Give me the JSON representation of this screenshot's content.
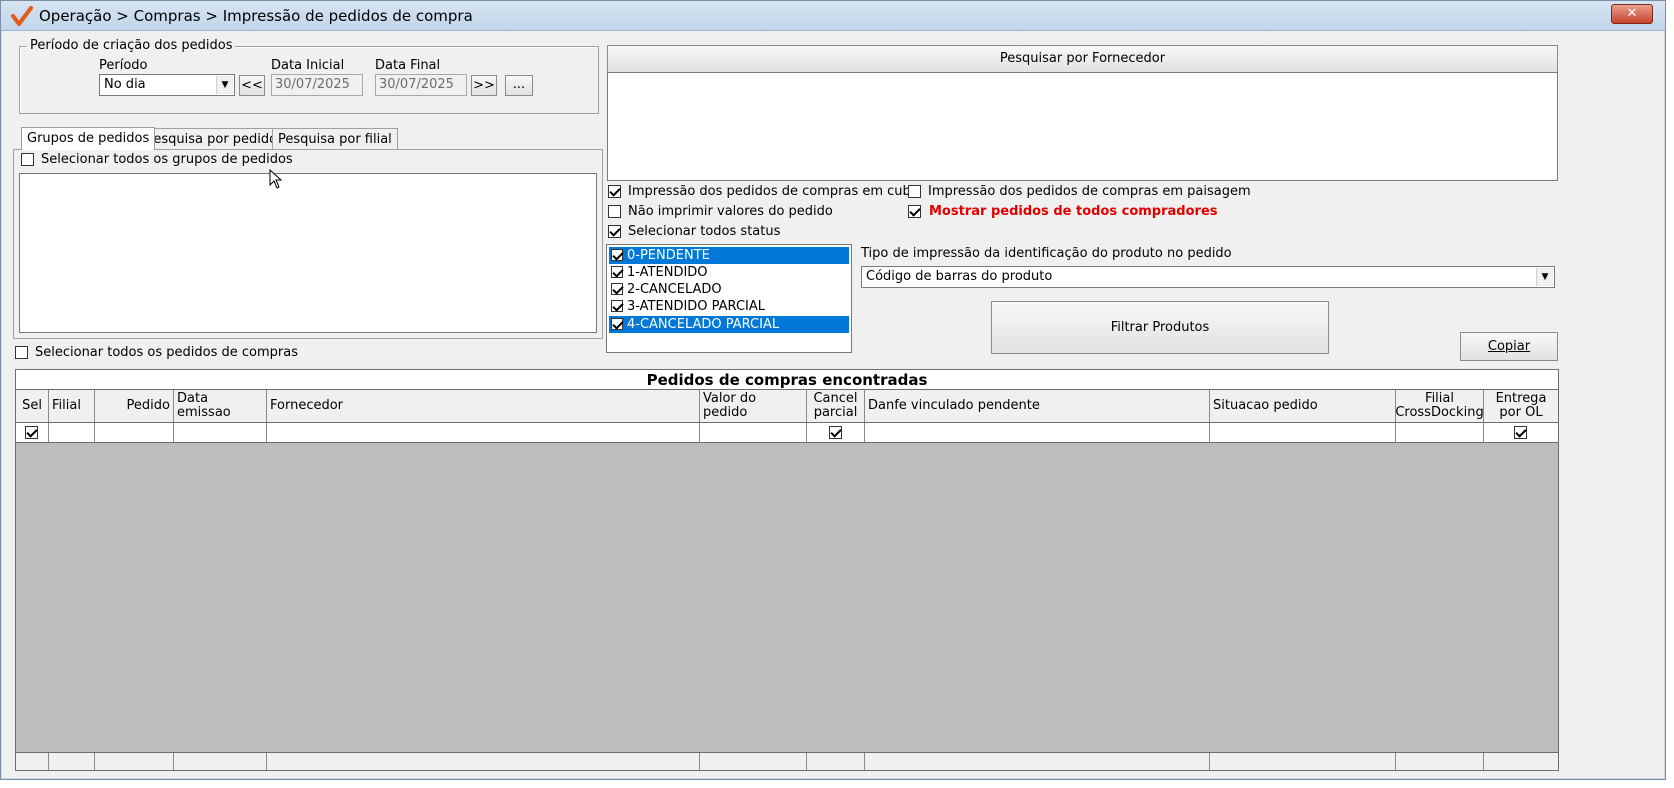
{
  "window": {
    "title": "Operação > Compras > Impressão de pedidos de compra",
    "close_label": "✕"
  },
  "periodo_group": {
    "legend": "Período de criação dos pedidos",
    "periodo_label": "Período",
    "periodo_value": "No dia",
    "prev_label": "<<",
    "data_inicial_label": "Data Inicial",
    "data_inicial_value": "30/07/2025",
    "data_final_label": "Data Final",
    "data_final_value": "30/07/2025",
    "next_label": ">>",
    "more_label": "..."
  },
  "tabs": [
    {
      "label": "Grupos de pedidos",
      "active": true
    },
    {
      "label": "Pesquisa por pedido",
      "active": false
    },
    {
      "label": "Pesquisa por filial",
      "active": false
    }
  ],
  "grupos": {
    "select_all_label": "Selecionar todos os grupos de pedidos",
    "select_all_checked": false
  },
  "select_all_pedidos_label": "Selecionar todos os pedidos de compras",
  "fornecedor": {
    "header_label": "Pesquisar por Fornecedor"
  },
  "options": {
    "cubo_label": "Impressão dos pedidos de compras em cubo",
    "cubo_checked": true,
    "paisagem_label": "Impressão dos pedidos de compras em paisagem",
    "paisagem_checked": false,
    "nao_imprimir_label": "Não imprimir valores do pedido",
    "nao_imprimir_checked": false,
    "mostrar_todos_label": "Mostrar pedidos de todos compradores",
    "mostrar_todos_checked": true,
    "mostrar_todos_color": "#e00000",
    "selecionar_status_label": "Selecionar todos status",
    "selecionar_status_checked": true
  },
  "status_list": [
    {
      "label": "0-PENDENTE",
      "checked": true,
      "selected": true
    },
    {
      "label": "1-ATENDIDO",
      "checked": true,
      "selected": false
    },
    {
      "label": "2-CANCELADO",
      "checked": true,
      "selected": false
    },
    {
      "label": "3-ATENDIDO PARCIAL",
      "checked": true,
      "selected": false
    },
    {
      "label": "4-CANCELADO PARCIAL",
      "checked": true,
      "selected": true
    }
  ],
  "tipo_impressao": {
    "label": "Tipo de impressão da identificação do produto no pedido",
    "value": "Código de barras do produto"
  },
  "buttons": {
    "filtrar_label": "Filtrar Produtos",
    "copiar_label": "Copiar"
  },
  "grid": {
    "caption": "Pedidos de compras encontradas",
    "columns": [
      {
        "label": "Sel"
      },
      {
        "label": "Filial"
      },
      {
        "label": "Pedido"
      },
      {
        "label": "Data emissao"
      },
      {
        "label": "Fornecedor"
      },
      {
        "label": "Valor do pedido"
      },
      {
        "label": "Cancel parcial"
      },
      {
        "label": "Danfe vinculado pendente"
      },
      {
        "label": "Situacao pedido"
      },
      {
        "label": "Filial CrossDocking"
      },
      {
        "label": "Entrega por OL"
      }
    ],
    "filter_row": {
      "sel_checked": true,
      "cancel_parcial_checked": true,
      "entrega_ol_checked": true
    }
  }
}
